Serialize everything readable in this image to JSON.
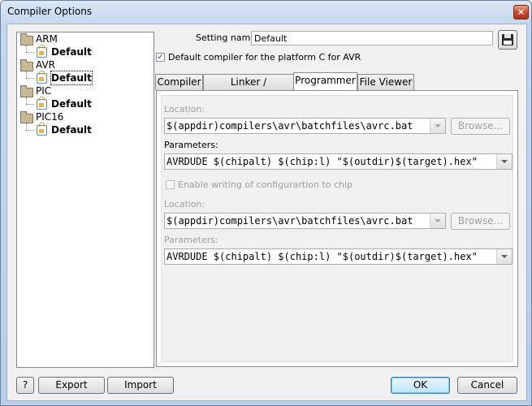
{
  "window": {
    "title": "Compiler Options",
    "close_glyph": "×"
  },
  "tree": {
    "items": [
      {
        "label": "ARM",
        "child": "Default"
      },
      {
        "label": "AVR",
        "child": "Default"
      },
      {
        "label": "PIC",
        "child": "Default"
      },
      {
        "label": "PIC16",
        "child": "Default"
      }
    ]
  },
  "settings": {
    "name_label": "Setting name:",
    "name_value": "Default",
    "default_compiler_label": "Default compiler for the platform C for AVR",
    "default_compiler_checked": true,
    "checkmark": "✓"
  },
  "tabs": [
    {
      "label": "Compiler"
    },
    {
      "label": "Linker / Assembler"
    },
    {
      "label": "Programmer",
      "active": true
    },
    {
      "label": "File Viewer"
    }
  ],
  "programmer": {
    "location1_label": "Location:",
    "location1_value": "$(appdir)compilers\\avr\\batchfiles\\avrc.bat",
    "browse1_label": "Browse...",
    "params1_label": "Parameters:",
    "params1_value": "AVRDUDE $(chipalt) $(chip:l) \"$(outdir)$(target).hex\"",
    "enable_config_label": "Enable writing of configurartion to chip",
    "location2_label": "Location:",
    "location2_value": "$(appdir)compilers\\avr\\batchfiles\\avrc.bat",
    "browse2_label": "Browse...",
    "params2_label": "Parameters:",
    "params2_value": "AVRDUDE $(chipalt) $(chip:l) \"$(outdir)$(target).hex\""
  },
  "footer": {
    "help_label": "?",
    "export_label": "Export",
    "import_label": "Import",
    "ok_label": "OK",
    "cancel_label": "Cancel"
  }
}
